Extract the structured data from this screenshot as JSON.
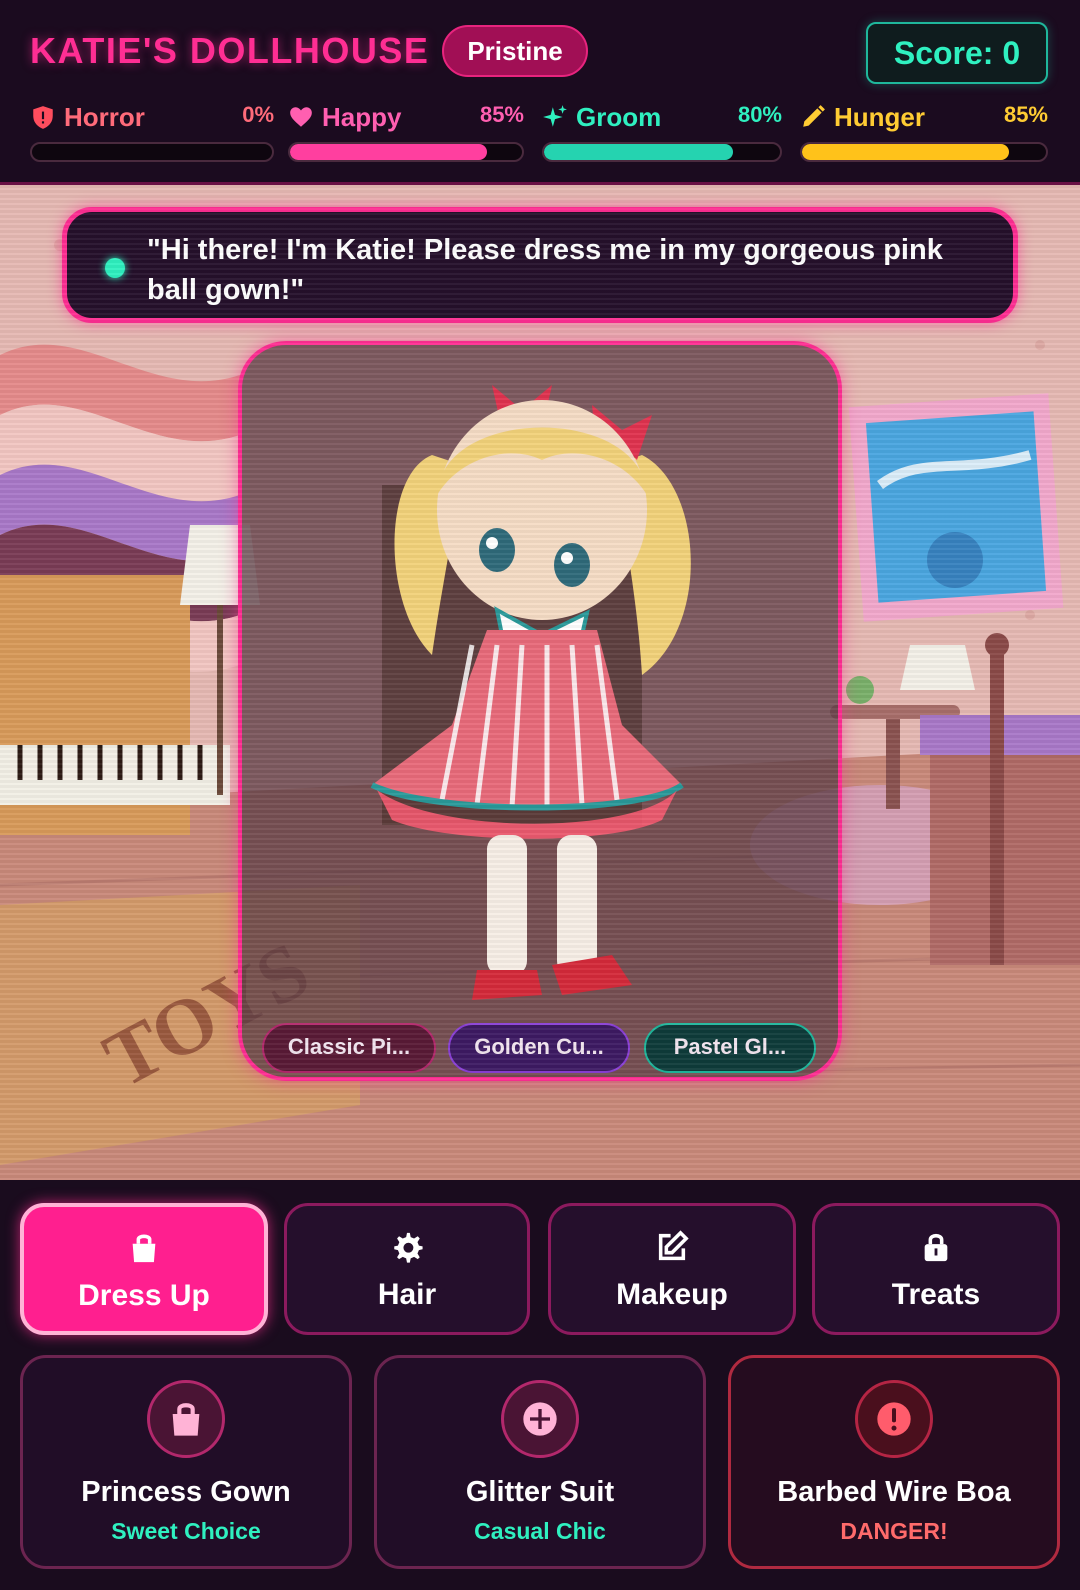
{
  "header": {
    "title": "KATIE'S DOLLHOUSE",
    "state_badge": "Pristine",
    "score": "Score: 0"
  },
  "stats": [
    {
      "label": "Horror",
      "value": "0%",
      "percent": 0,
      "icon": "shield-alert-icon",
      "color": "#ff6b7a",
      "bar_color": "#ff6b7a"
    },
    {
      "label": "Happy",
      "value": "85%",
      "percent": 85,
      "icon": "heart-icon",
      "color": "#ff5fb0",
      "bar_color": "#ff3f9f"
    },
    {
      "label": "Groom",
      "value": "80%",
      "percent": 80,
      "icon": "sparkles-icon",
      "color": "#2ff0c0",
      "bar_color": "#25d3b0"
    },
    {
      "label": "Hunger",
      "value": "85%",
      "percent": 85,
      "icon": "pencil-icon",
      "color": "#ffcc33",
      "bar_color": "#ffc21a"
    }
  ],
  "speech": {
    "text": "\"Hi there! I'm Katie! Please dress me in my gorgeous pink ball gown!\""
  },
  "presets": [
    {
      "label": "Classic Pi...",
      "bg": "#5a1a36",
      "border": "#b3286c"
    },
    {
      "label": "Golden Cu...",
      "bg": "#3d1a63",
      "border": "#8a3fd6"
    },
    {
      "label": "Pastel Gl...",
      "bg": "#0f3b3a",
      "border": "#1fb79c"
    }
  ],
  "tabs": [
    {
      "label": "Dress Up",
      "icon": "shopping-bag-icon",
      "active": true
    },
    {
      "label": "Hair",
      "icon": "gear-icon",
      "active": false
    },
    {
      "label": "Makeup",
      "icon": "edit-icon",
      "active": false
    },
    {
      "label": "Treats",
      "icon": "lock-icon",
      "active": false
    }
  ],
  "items": [
    {
      "title": "Princess Gown",
      "subtitle": "Sweet Choice",
      "icon": "shopping-bag-icon",
      "subtitle_color": "#2ff0c0"
    },
    {
      "title": "Glitter Suit",
      "subtitle": "Casual Chic",
      "icon": "plus-circle-icon",
      "subtitle_color": "#2ff0c0"
    },
    {
      "title": "Barbed Wire Boa",
      "subtitle": "DANGER!",
      "icon": "alert-circle-icon",
      "subtitle_color": "#ff6b6b"
    }
  ],
  "colors": {
    "accent_pink": "#ff2e93",
    "accent_teal": "#2ff0c0",
    "background": "#1a0c1e"
  }
}
